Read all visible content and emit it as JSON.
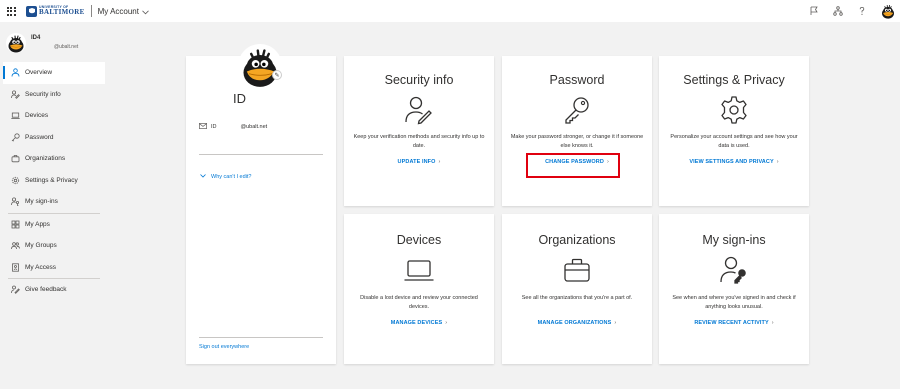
{
  "topbar": {
    "logo_small": "UNIVERSITY OF",
    "logo_big": "BALTIMORE",
    "app_title": "My Account"
  },
  "profile": {
    "name": "ID4",
    "email": "@ubalt.net"
  },
  "sidebar": {
    "items": [
      {
        "label": "Overview",
        "icon": "person-icon"
      },
      {
        "label": "Security info",
        "icon": "security-info-icon"
      },
      {
        "label": "Devices",
        "icon": "laptop-icon"
      },
      {
        "label": "Password",
        "icon": "key-icon"
      },
      {
        "label": "Organizations",
        "icon": "briefcase-icon"
      },
      {
        "label": "Settings & Privacy",
        "icon": "gear-icon"
      },
      {
        "label": "My sign-ins",
        "icon": "signins-icon"
      },
      {
        "label": "My Apps",
        "icon": "apps-icon"
      },
      {
        "label": "My Groups",
        "icon": "groups-icon"
      },
      {
        "label": "My Access",
        "icon": "access-icon"
      },
      {
        "label": "Give feedback",
        "icon": "feedback-icon"
      }
    ]
  },
  "profile_card": {
    "title": "ID",
    "mail_label": "ID",
    "mail_value": "@ubalt.net",
    "why_cant_edit": "Why can't I edit?",
    "sign_out": "Sign out everywhere"
  },
  "tiles": {
    "security": {
      "title": "Security info",
      "desc": "Keep your verification methods and security info up to date.",
      "link": "UPDATE INFO"
    },
    "password": {
      "title": "Password",
      "desc": "Make your password stronger, or change it if someone else knows it.",
      "link": "CHANGE PASSWORD"
    },
    "settings": {
      "title": "Settings & Privacy",
      "desc": "Personalize your account settings and see how your data is used.",
      "link": "VIEW SETTINGS AND PRIVACY"
    },
    "devices": {
      "title": "Devices",
      "desc": "Disable a lost device and review your connected devices.",
      "link": "MANAGE DEVICES"
    },
    "organizations": {
      "title": "Organizations",
      "desc": "See all the organizations that you're a part of.",
      "link": "MANAGE ORGANIZATIONS"
    },
    "signins": {
      "title": "My sign-ins",
      "desc": "See when and where you've signed in and check if anything looks unusual.",
      "link": "REVIEW RECENT ACTIVITY"
    }
  },
  "colors": {
    "accent": "#0078d4",
    "highlight": "#e0000f",
    "background": "#f2f2f2"
  }
}
